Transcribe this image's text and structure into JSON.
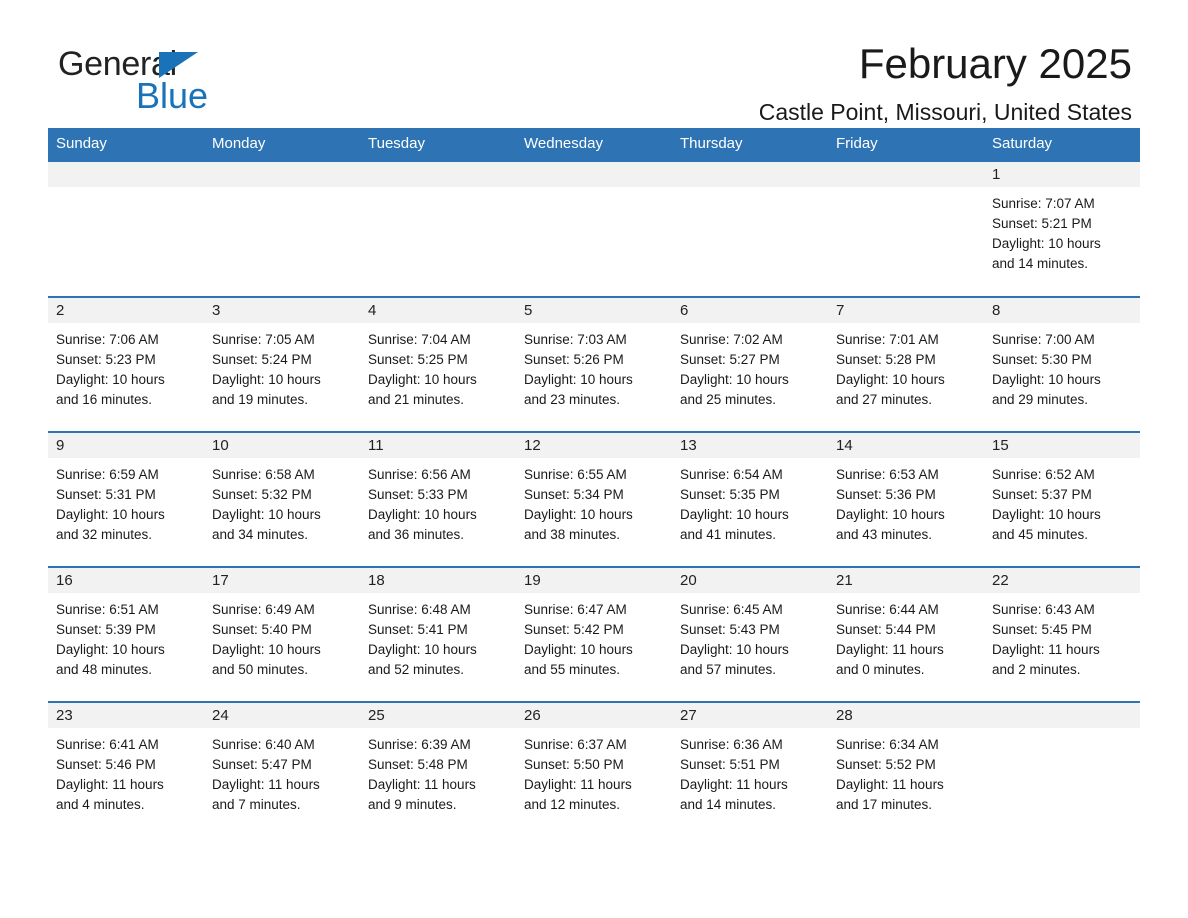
{
  "brand": {
    "name_top": "General",
    "name_bottom": "Blue",
    "accent_color": "#1a73b8",
    "header_color": "#2e74b5"
  },
  "header": {
    "title": "February 2025",
    "location": "Castle Point, Missouri, United States"
  },
  "weekday_headers": [
    "Sunday",
    "Monday",
    "Tuesday",
    "Wednesday",
    "Thursday",
    "Friday",
    "Saturday"
  ],
  "labels": {
    "sunrise_prefix": "Sunrise: ",
    "sunset_prefix": "Sunset: ",
    "daylight_prefix": "Daylight: "
  },
  "weeks": [
    [
      {
        "day": "",
        "sunrise": "",
        "sunset": "",
        "daylight_l1": "",
        "daylight_l2": ""
      },
      {
        "day": "",
        "sunrise": "",
        "sunset": "",
        "daylight_l1": "",
        "daylight_l2": ""
      },
      {
        "day": "",
        "sunrise": "",
        "sunset": "",
        "daylight_l1": "",
        "daylight_l2": ""
      },
      {
        "day": "",
        "sunrise": "",
        "sunset": "",
        "daylight_l1": "",
        "daylight_l2": ""
      },
      {
        "day": "",
        "sunrise": "",
        "sunset": "",
        "daylight_l1": "",
        "daylight_l2": ""
      },
      {
        "day": "",
        "sunrise": "",
        "sunset": "",
        "daylight_l1": "",
        "daylight_l2": ""
      },
      {
        "day": "1",
        "sunrise": "Sunrise: 7:07 AM",
        "sunset": "Sunset: 5:21 PM",
        "daylight_l1": "Daylight: 10 hours",
        "daylight_l2": "and 14 minutes."
      }
    ],
    [
      {
        "day": "2",
        "sunrise": "Sunrise: 7:06 AM",
        "sunset": "Sunset: 5:23 PM",
        "daylight_l1": "Daylight: 10 hours",
        "daylight_l2": "and 16 minutes."
      },
      {
        "day": "3",
        "sunrise": "Sunrise: 7:05 AM",
        "sunset": "Sunset: 5:24 PM",
        "daylight_l1": "Daylight: 10 hours",
        "daylight_l2": "and 19 minutes."
      },
      {
        "day": "4",
        "sunrise": "Sunrise: 7:04 AM",
        "sunset": "Sunset: 5:25 PM",
        "daylight_l1": "Daylight: 10 hours",
        "daylight_l2": "and 21 minutes."
      },
      {
        "day": "5",
        "sunrise": "Sunrise: 7:03 AM",
        "sunset": "Sunset: 5:26 PM",
        "daylight_l1": "Daylight: 10 hours",
        "daylight_l2": "and 23 minutes."
      },
      {
        "day": "6",
        "sunrise": "Sunrise: 7:02 AM",
        "sunset": "Sunset: 5:27 PM",
        "daylight_l1": "Daylight: 10 hours",
        "daylight_l2": "and 25 minutes."
      },
      {
        "day": "7",
        "sunrise": "Sunrise: 7:01 AM",
        "sunset": "Sunset: 5:28 PM",
        "daylight_l1": "Daylight: 10 hours",
        "daylight_l2": "and 27 minutes."
      },
      {
        "day": "8",
        "sunrise": "Sunrise: 7:00 AM",
        "sunset": "Sunset: 5:30 PM",
        "daylight_l1": "Daylight: 10 hours",
        "daylight_l2": "and 29 minutes."
      }
    ],
    [
      {
        "day": "9",
        "sunrise": "Sunrise: 6:59 AM",
        "sunset": "Sunset: 5:31 PM",
        "daylight_l1": "Daylight: 10 hours",
        "daylight_l2": "and 32 minutes."
      },
      {
        "day": "10",
        "sunrise": "Sunrise: 6:58 AM",
        "sunset": "Sunset: 5:32 PM",
        "daylight_l1": "Daylight: 10 hours",
        "daylight_l2": "and 34 minutes."
      },
      {
        "day": "11",
        "sunrise": "Sunrise: 6:56 AM",
        "sunset": "Sunset: 5:33 PM",
        "daylight_l1": "Daylight: 10 hours",
        "daylight_l2": "and 36 minutes."
      },
      {
        "day": "12",
        "sunrise": "Sunrise: 6:55 AM",
        "sunset": "Sunset: 5:34 PM",
        "daylight_l1": "Daylight: 10 hours",
        "daylight_l2": "and 38 minutes."
      },
      {
        "day": "13",
        "sunrise": "Sunrise: 6:54 AM",
        "sunset": "Sunset: 5:35 PM",
        "daylight_l1": "Daylight: 10 hours",
        "daylight_l2": "and 41 minutes."
      },
      {
        "day": "14",
        "sunrise": "Sunrise: 6:53 AM",
        "sunset": "Sunset: 5:36 PM",
        "daylight_l1": "Daylight: 10 hours",
        "daylight_l2": "and 43 minutes."
      },
      {
        "day": "15",
        "sunrise": "Sunrise: 6:52 AM",
        "sunset": "Sunset: 5:37 PM",
        "daylight_l1": "Daylight: 10 hours",
        "daylight_l2": "and 45 minutes."
      }
    ],
    [
      {
        "day": "16",
        "sunrise": "Sunrise: 6:51 AM",
        "sunset": "Sunset: 5:39 PM",
        "daylight_l1": "Daylight: 10 hours",
        "daylight_l2": "and 48 minutes."
      },
      {
        "day": "17",
        "sunrise": "Sunrise: 6:49 AM",
        "sunset": "Sunset: 5:40 PM",
        "daylight_l1": "Daylight: 10 hours",
        "daylight_l2": "and 50 minutes."
      },
      {
        "day": "18",
        "sunrise": "Sunrise: 6:48 AM",
        "sunset": "Sunset: 5:41 PM",
        "daylight_l1": "Daylight: 10 hours",
        "daylight_l2": "and 52 minutes."
      },
      {
        "day": "19",
        "sunrise": "Sunrise: 6:47 AM",
        "sunset": "Sunset: 5:42 PM",
        "daylight_l1": "Daylight: 10 hours",
        "daylight_l2": "and 55 minutes."
      },
      {
        "day": "20",
        "sunrise": "Sunrise: 6:45 AM",
        "sunset": "Sunset: 5:43 PM",
        "daylight_l1": "Daylight: 10 hours",
        "daylight_l2": "and 57 minutes."
      },
      {
        "day": "21",
        "sunrise": "Sunrise: 6:44 AM",
        "sunset": "Sunset: 5:44 PM",
        "daylight_l1": "Daylight: 11 hours",
        "daylight_l2": "and 0 minutes."
      },
      {
        "day": "22",
        "sunrise": "Sunrise: 6:43 AM",
        "sunset": "Sunset: 5:45 PM",
        "daylight_l1": "Daylight: 11 hours",
        "daylight_l2": "and 2 minutes."
      }
    ],
    [
      {
        "day": "23",
        "sunrise": "Sunrise: 6:41 AM",
        "sunset": "Sunset: 5:46 PM",
        "daylight_l1": "Daylight: 11 hours",
        "daylight_l2": "and 4 minutes."
      },
      {
        "day": "24",
        "sunrise": "Sunrise: 6:40 AM",
        "sunset": "Sunset: 5:47 PM",
        "daylight_l1": "Daylight: 11 hours",
        "daylight_l2": "and 7 minutes."
      },
      {
        "day": "25",
        "sunrise": "Sunrise: 6:39 AM",
        "sunset": "Sunset: 5:48 PM",
        "daylight_l1": "Daylight: 11 hours",
        "daylight_l2": "and 9 minutes."
      },
      {
        "day": "26",
        "sunrise": "Sunrise: 6:37 AM",
        "sunset": "Sunset: 5:50 PM",
        "daylight_l1": "Daylight: 11 hours",
        "daylight_l2": "and 12 minutes."
      },
      {
        "day": "27",
        "sunrise": "Sunrise: 6:36 AM",
        "sunset": "Sunset: 5:51 PM",
        "daylight_l1": "Daylight: 11 hours",
        "daylight_l2": "and 14 minutes."
      },
      {
        "day": "28",
        "sunrise": "Sunrise: 6:34 AM",
        "sunset": "Sunset: 5:52 PM",
        "daylight_l1": "Daylight: 11 hours",
        "daylight_l2": "and 17 minutes."
      },
      {
        "day": "",
        "sunrise": "",
        "sunset": "",
        "daylight_l1": "",
        "daylight_l2": ""
      }
    ]
  ]
}
